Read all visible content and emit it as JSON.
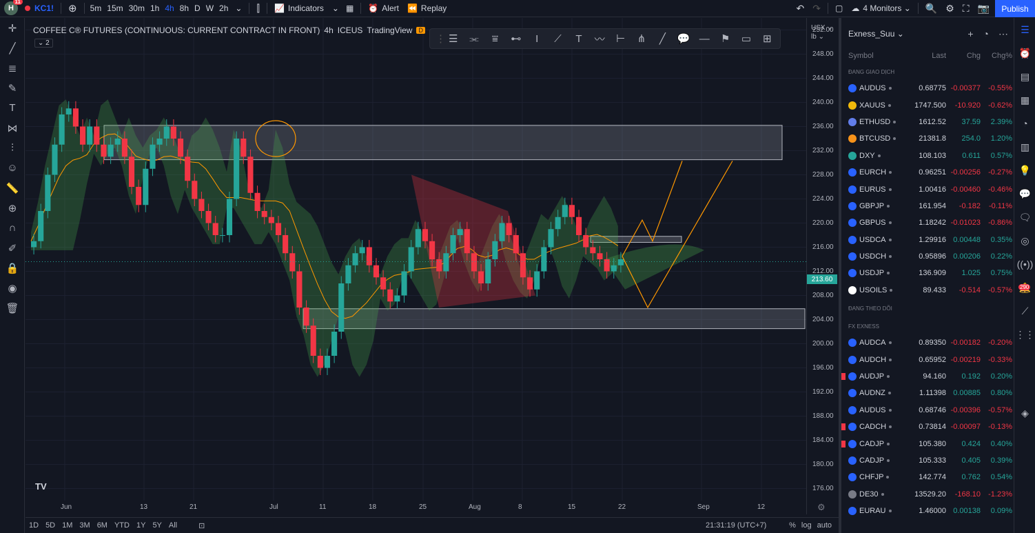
{
  "topbar": {
    "logo_letter": "H",
    "logo_badge": "11",
    "symbol": "KC1!",
    "intervals": [
      "5m",
      "15m",
      "30m",
      "1h",
      "4h",
      "8h",
      "D",
      "W",
      "2h"
    ],
    "active_interval": "4h",
    "indicators_label": "Indicators",
    "alert_label": "Alert",
    "replay_label": "Replay",
    "layout_label": "4 Monitors",
    "publish_label": "Publish"
  },
  "chart": {
    "legend_title": "COFFEE C® FUTURES (CONTINUOUS: CURRENT CONTRACT IN FRONT)",
    "legend_interval": "4h",
    "legend_exchange": "ICEUS",
    "legend_source": "TradingView",
    "legend_badge": "D",
    "indicator_count": "2",
    "current_price": "213.60",
    "units_currency": "USX",
    "units_weight": "lb",
    "clock": "21:31:19 (UTC+7)"
  },
  "chart_data": {
    "type": "candlestick",
    "ylim": [
      174,
      254
    ],
    "price_ticks": [
      "252.00",
      "248.00",
      "244.00",
      "240.00",
      "236.00",
      "232.00",
      "228.00",
      "224.00",
      "220.00",
      "216.00",
      "212.00",
      "208.00",
      "204.00",
      "200.00",
      "196.00",
      "192.00",
      "188.00",
      "184.00",
      "180.00",
      "176.00"
    ],
    "time_ticks": [
      "Jun",
      "13",
      "21",
      "Jul",
      "11",
      "18",
      "25",
      "Aug",
      "8",
      "15",
      "22",
      "Sep",
      "12"
    ],
    "close_path": [
      217,
      222,
      228,
      233,
      238,
      239,
      236,
      233,
      236,
      233,
      231,
      233,
      234,
      231,
      226,
      223,
      229,
      233,
      234,
      236,
      234,
      231,
      227,
      224,
      222,
      220,
      218,
      218,
      224,
      234,
      231,
      225,
      222,
      221,
      220,
      218,
      215,
      212,
      206,
      203,
      198,
      196,
      198,
      202,
      210,
      213,
      215,
      216,
      213,
      211,
      209,
      207,
      208,
      212,
      216,
      219,
      217,
      214,
      212,
      215,
      218,
      219,
      215,
      212,
      210,
      214,
      217,
      220,
      218,
      215,
      211,
      209,
      212,
      216,
      219,
      221,
      223,
      221,
      218,
      216,
      215,
      214,
      212,
      213,
      214
    ],
    "resistance_zone": [
      230.5,
      236.2
    ],
    "support_zone": [
      202.5,
      205.8
    ],
    "box_zone": [
      216.8,
      217.8
    ]
  },
  "bottombar": {
    "ranges": [
      "1D",
      "5D",
      "1M",
      "3M",
      "6M",
      "YTD",
      "1Y",
      "5Y",
      "All"
    ],
    "percent_label": "%",
    "log_label": "log",
    "auto_label": "auto"
  },
  "watchlist": {
    "name": "Exness_Suu",
    "col_symbol": "Symbol",
    "col_last": "Last",
    "col_chg": "Chg",
    "col_chgp": "Chg%",
    "section1": "ĐANG GIAO DỊCH",
    "section2": "ĐANG THEO DÕI",
    "section3": "FX EXNESS",
    "group1": [
      {
        "sym": "AUDUS",
        "last": "0.68775",
        "chg": "-0.00377",
        "chgp": "-0.55%",
        "color": "#2962ff"
      },
      {
        "sym": "XAUUS",
        "last": "1747.500",
        "chg": "-10.920",
        "chgp": "-0.62%",
        "color": "#f0b90b"
      },
      {
        "sym": "ETHUSD",
        "last": "1612.52",
        "chg": "37.59",
        "chgp": "2.39%",
        "color": "#627eea"
      },
      {
        "sym": "BTCUSD",
        "last": "21381.8",
        "chg": "254.0",
        "chgp": "1.20%",
        "color": "#f7931a"
      },
      {
        "sym": "DXY",
        "last": "108.103",
        "chg": "0.611",
        "chgp": "0.57%",
        "color": "#26a69a"
      },
      {
        "sym": "EURCH",
        "last": "0.96251",
        "chg": "-0.00256",
        "chgp": "-0.27%",
        "color": "#2962ff"
      },
      {
        "sym": "EURUS",
        "last": "1.00416",
        "chg": "-0.00460",
        "chgp": "-0.46%",
        "color": "#2962ff"
      },
      {
        "sym": "GBPJP",
        "last": "161.954",
        "chg": "-0.182",
        "chgp": "-0.11%",
        "color": "#2962ff"
      },
      {
        "sym": "GBPUS",
        "last": "1.18242",
        "chg": "-0.01023",
        "chgp": "-0.86%",
        "color": "#2962ff"
      },
      {
        "sym": "USDCA",
        "last": "1.29916",
        "chg": "0.00448",
        "chgp": "0.35%",
        "color": "#2962ff"
      },
      {
        "sym": "USDCH",
        "last": "0.95896",
        "chg": "0.00206",
        "chgp": "0.22%",
        "color": "#2962ff"
      },
      {
        "sym": "USDJP",
        "last": "136.909",
        "chg": "1.025",
        "chgp": "0.75%",
        "color": "#2962ff"
      },
      {
        "sym": "USOILS",
        "last": "89.433",
        "chg": "-0.514",
        "chgp": "-0.57%",
        "color": "#ffffff"
      }
    ],
    "group2": [
      {
        "sym": "AUDCA",
        "last": "0.89350",
        "chg": "-0.00182",
        "chgp": "-0.20%",
        "color": "#2962ff"
      },
      {
        "sym": "AUDCH",
        "last": "0.65952",
        "chg": "-0.00219",
        "chgp": "-0.33%",
        "color": "#2962ff"
      },
      {
        "sym": "AUDJP",
        "last": "94.160",
        "chg": "0.192",
        "chgp": "0.20%",
        "color": "#2962ff"
      },
      {
        "sym": "AUDNZ",
        "last": "1.11398",
        "chg": "0.00885",
        "chgp": "0.80%",
        "color": "#2962ff"
      },
      {
        "sym": "AUDUS",
        "last": "0.68746",
        "chg": "-0.00396",
        "chgp": "-0.57%",
        "color": "#2962ff"
      },
      {
        "sym": "CADCH",
        "last": "0.73814",
        "chg": "-0.00097",
        "chgp": "-0.13%",
        "color": "#2962ff"
      },
      {
        "sym": "CADJP",
        "last": "105.380",
        "chg": "0.424",
        "chgp": "0.40%",
        "color": "#2962ff"
      },
      {
        "sym": "CADJP",
        "last": "105.333",
        "chg": "0.405",
        "chgp": "0.39%",
        "color": "#2962ff"
      },
      {
        "sym": "CHFJP",
        "last": "142.774",
        "chg": "0.762",
        "chgp": "0.54%",
        "color": "#2962ff"
      },
      {
        "sym": "DE30",
        "last": "13529.20",
        "chg": "-168.10",
        "chgp": "-1.23%",
        "color": "#787b86"
      },
      {
        "sym": "EURAU",
        "last": "1.46000",
        "chg": "0.00138",
        "chgp": "0.09%",
        "color": "#2962ff"
      }
    ]
  },
  "rail": {
    "badge": "290"
  }
}
